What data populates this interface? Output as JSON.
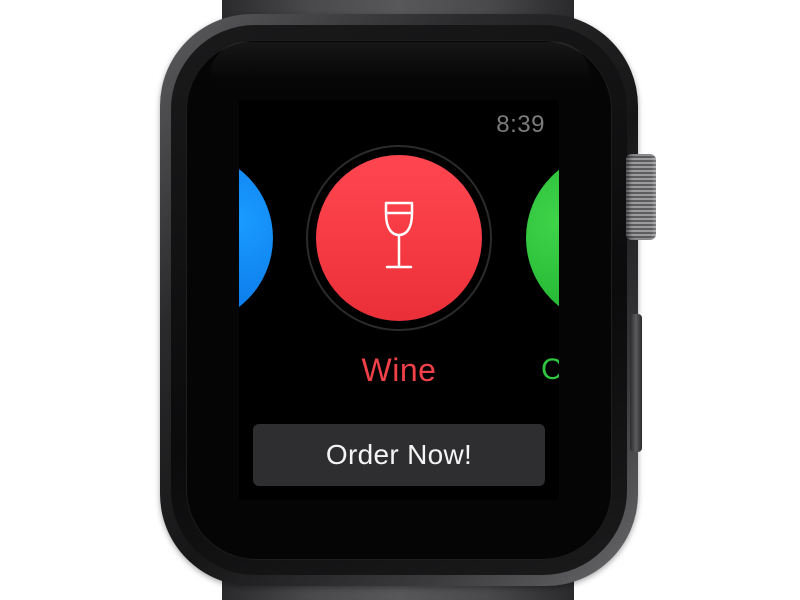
{
  "watch": {
    "time": "8:39"
  },
  "carousel": {
    "previous": {
      "color": "#0a78e8",
      "icon": "blue-drink-circle"
    },
    "selected": {
      "label": "Wine",
      "color": "#f53a43",
      "icon": "wine-glass-icon"
    },
    "next": {
      "label_partial": "C",
      "color": "#22b532",
      "icon": "green-drink-circle"
    }
  },
  "action": {
    "order_label": "Order Now!"
  },
  "colors": {
    "screen_background": "#000000",
    "button_background": "#2e2e30",
    "selected_text": "#f04048",
    "next_text": "#2fc53f"
  }
}
